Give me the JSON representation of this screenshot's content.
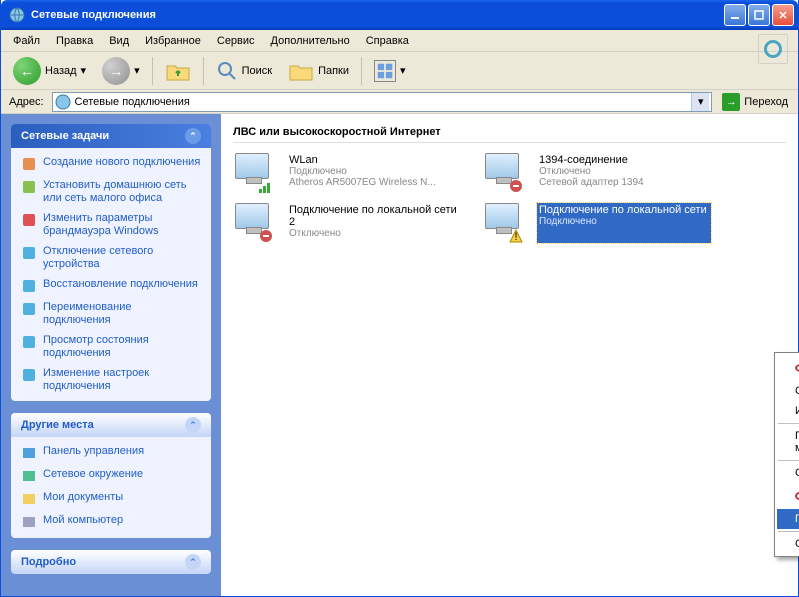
{
  "window": {
    "title": "Сетевые подключения"
  },
  "menu": [
    "Файл",
    "Правка",
    "Вид",
    "Избранное",
    "Сервис",
    "Дополнительно",
    "Справка"
  ],
  "toolbar": {
    "back": "Назад",
    "search": "Поиск",
    "folders": "Папки"
  },
  "address": {
    "label": "Адрес:",
    "value": "Сетевые подключения",
    "go": "Переход"
  },
  "sidebar": {
    "tasks": {
      "title": "Сетевые задачи",
      "items": [
        "Создание нового подключения",
        "Установить домашнюю сеть или сеть малого офиса",
        "Изменить параметры брандмауэра Windows",
        "Отключение сетевого устройства",
        "Восстановление подключения",
        "Переименование подключения",
        "Просмотр состояния подключения",
        "Изменение настроек подключения"
      ]
    },
    "places": {
      "title": "Другие места",
      "items": [
        "Панель управления",
        "Сетевое окружение",
        "Мои документы",
        "Мой компьютер"
      ]
    },
    "details": {
      "title": "Подробно"
    }
  },
  "section_title": "ЛВС или высокоскоростной Интернет",
  "connections": [
    {
      "name": "WLan",
      "status": "Подключено",
      "detail": "Atheros AR5007EG Wireless N...",
      "icon": "wifi"
    },
    {
      "name": "1394-соединение",
      "status": "Отключено",
      "detail": "Сетевой адаптер 1394",
      "icon": "off"
    },
    {
      "name": "Подключение по локальной сети 2",
      "status": "Отключено",
      "detail": "",
      "icon": "off"
    },
    {
      "name": "Подключение по локальной сети",
      "status": "Подключено",
      "detail": "",
      "icon": "warn",
      "selected": true
    }
  ],
  "context_menu": [
    {
      "label": "Отключить",
      "bold": true,
      "circled": true
    },
    {
      "label": "Состояние"
    },
    {
      "label": "Исправить"
    },
    {
      "sep": true
    },
    {
      "label": "Подключения типа мост"
    },
    {
      "sep": true
    },
    {
      "label": "Создать ярлык"
    },
    {
      "label": "Удалить",
      "disabled": true,
      "circled": true
    },
    {
      "label": "Переименовать",
      "highlight": true
    },
    {
      "sep": true
    },
    {
      "label": "Свойства"
    }
  ]
}
